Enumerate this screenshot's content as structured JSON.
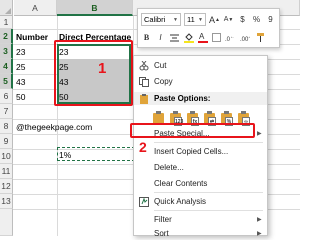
{
  "sheet": {
    "columns": [
      "A",
      "B"
    ],
    "rows": [
      "1",
      "2",
      "3",
      "4",
      "5",
      "6",
      "7",
      "8",
      "9",
      "10",
      "11",
      "12",
      "13"
    ],
    "cells": {
      "A1": "Number",
      "B1": "Direct Percentage",
      "A2": "23",
      "B2": "23",
      "A3": "25",
      "B3": "25",
      "A4": "43",
      "B4": "43",
      "A5": "50",
      "B5": "50",
      "A7": "@thegeekpage.com",
      "B10": "1%"
    }
  },
  "annotations": {
    "step1": "1",
    "step2": "2"
  },
  "mini_toolbar": {
    "font": "Calibri",
    "size": "11",
    "grow_font": "A",
    "shrink_font": "A",
    "currency": "$",
    "percent": "%",
    "comma": "9",
    "bold": "B",
    "italic": "I",
    "font_color": "A"
  },
  "context_menu": {
    "cut": "Cut",
    "copy": "Copy",
    "paste_options": "Paste Options:",
    "paste_special": "Paste Special...",
    "insert_copied_cells": "Insert Copied Cells...",
    "delete": "Delete...",
    "clear_contents": "Clear Contents",
    "quick_analysis": "Quick Analysis",
    "filter": "Filter",
    "sort": "Sort"
  },
  "colors": {
    "accent": "#217346",
    "annotation_red": "#e8141b",
    "clip": "#e0a43a"
  }
}
